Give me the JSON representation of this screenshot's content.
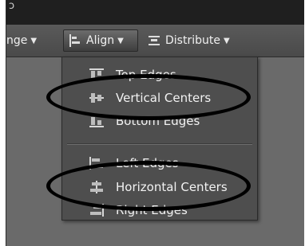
{
  "toolbar": {
    "range_label": "nge",
    "align_label": "Align",
    "distribute_label": "Distribute"
  },
  "menu": {
    "items": [
      {
        "label": "Top Edges",
        "icon": "align-top-edges-icon"
      },
      {
        "label": "Vertical Centers",
        "icon": "align-vertical-centers-icon"
      },
      {
        "label": "Bottom Edges",
        "icon": "align-bottom-edges-icon"
      },
      {
        "label": "Left Edges",
        "icon": "align-left-edges-icon"
      },
      {
        "label": "Horizontal Centers",
        "icon": "align-horizontal-centers-icon"
      },
      {
        "label": "Right Edges",
        "icon": "align-right-edges-icon"
      }
    ]
  },
  "colors": {
    "menu_bg": "#4e4e4e",
    "toolbar_bg": "#4f4f4f",
    "title_bar": "#1f1f1f",
    "canvas": "#6a6a6a",
    "highlight_ellipse": "#000000"
  }
}
